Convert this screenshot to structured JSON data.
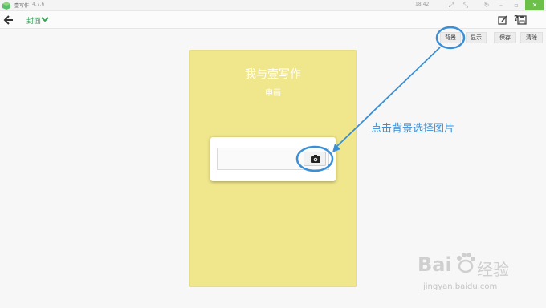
{
  "titlebar": {
    "app_name": "壹写作",
    "version": "4.7.6",
    "clock": "18:42",
    "close_label": "✕"
  },
  "toolbar": {
    "breadcrumb": "封面"
  },
  "actions": {
    "background": "背景",
    "display": "显示",
    "save": "保存",
    "clear": "清除"
  },
  "cover": {
    "title": "我与壹写作",
    "subtitle": "申画",
    "color": "#f0e68c"
  },
  "annotation": {
    "text": "点击背景选择图片",
    "color": "#3a8fd6"
  },
  "watermark": {
    "brand": "Bai",
    "brand_cn": "经验",
    "url": "jingyan.baidu.com"
  }
}
